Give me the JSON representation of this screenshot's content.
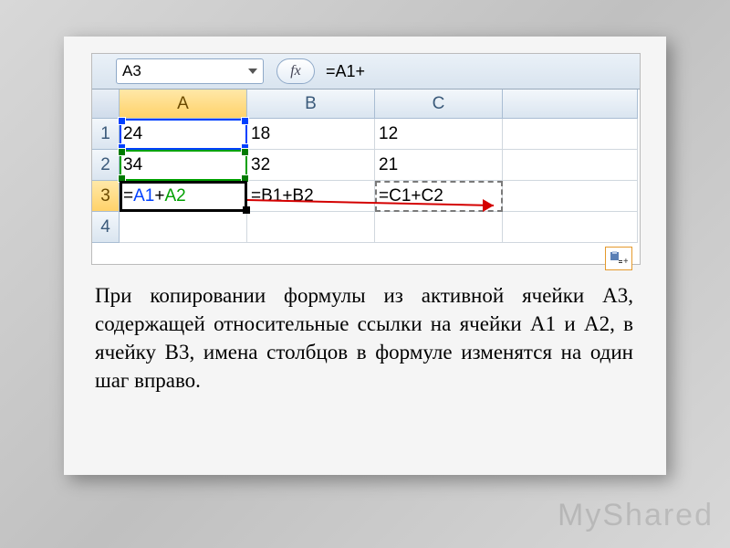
{
  "formula_bar": {
    "name_box": "A3",
    "fx_label": "fx",
    "formula_text": "=A1+"
  },
  "columns": [
    "A",
    "B",
    "C"
  ],
  "rows": [
    "1",
    "2",
    "3",
    "4"
  ],
  "selected_column": "A",
  "selected_row": "3",
  "cells": {
    "A1": "24",
    "B1": "18",
    "C1": "12",
    "A2": "34",
    "B2": "32",
    "C2": "21",
    "B3": "=B1+B2",
    "C3": "=C1+C2"
  },
  "a3_parts": {
    "prefix": "=",
    "ref1": "A1",
    "plus": "+",
    "ref2": "A2"
  },
  "caption_text": "При копировании формулы из активной ячейки A3, содержащей относительные ссылки на ячейки A1 и A2, в ячейку B3, имена столбцов в формуле изменятся на один шаг вправо.",
  "watermark": "MyShared",
  "icons": {
    "paste_options": "paste-options-icon"
  }
}
